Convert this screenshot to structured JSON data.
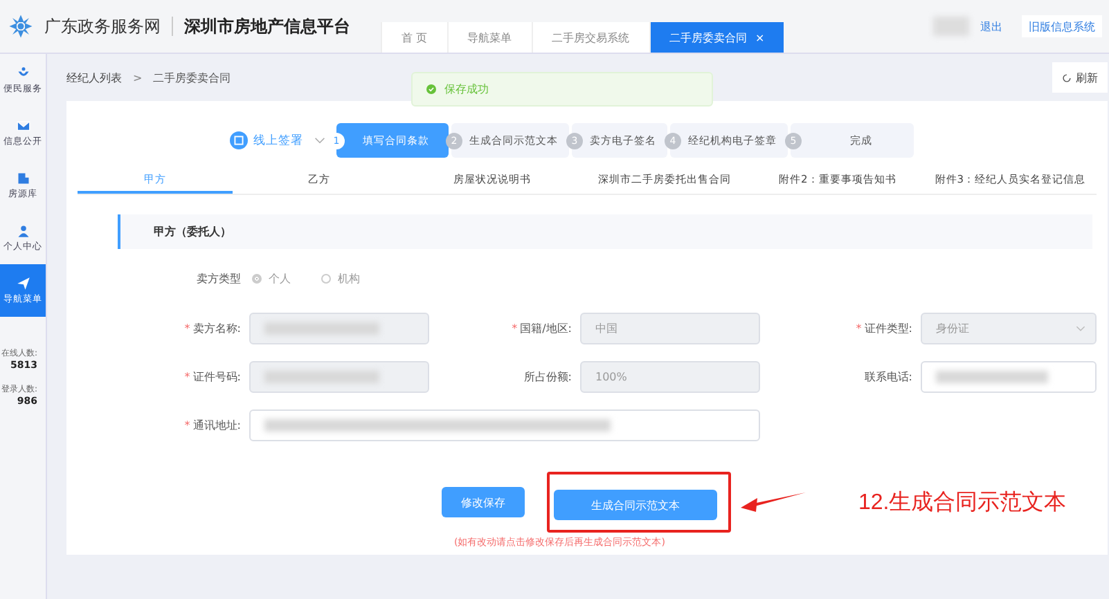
{
  "header": {
    "site_name": "广东政务服务网",
    "platform": "深圳市房地产信息平台",
    "logout": "退出",
    "old_system": "旧版信息系统",
    "tabs": [
      {
        "label": "首 页",
        "selected": false
      },
      {
        "label": "导航菜单",
        "selected": false
      },
      {
        "label": "二手房交易系统",
        "selected": false
      },
      {
        "label": "二手房委卖合同",
        "selected": true,
        "close": "×"
      }
    ]
  },
  "sidebar": {
    "items": [
      {
        "label": "便民服务",
        "kind": "service",
        "selected": false
      },
      {
        "label": "信息公开",
        "kind": "mail",
        "selected": false
      },
      {
        "label": "房源库",
        "kind": "building",
        "selected": false
      },
      {
        "label": "个人中心",
        "kind": "person",
        "selected": false
      },
      {
        "label": "导航菜单",
        "kind": "send",
        "selected": true
      }
    ],
    "stats": [
      {
        "label": "在线人数:",
        "value": "5813"
      },
      {
        "label": "登录人数:",
        "value": "986"
      }
    ]
  },
  "breadcrumb": {
    "items": [
      "经纪人列表",
      "二手房委卖合同"
    ],
    "separator": ">"
  },
  "toast": "保存成功",
  "refresh": "刷新",
  "steps": {
    "title": "线上签署",
    "items": [
      {
        "number": "1",
        "label": "填写合同条款",
        "selected": true
      },
      {
        "number": "2",
        "label": "生成合同示范文本",
        "selected": false
      },
      {
        "number": "3",
        "label": "卖方电子签名",
        "selected": false
      },
      {
        "number": "4",
        "label": "经纪机构电子签章",
        "selected": false
      },
      {
        "number": "5",
        "label": "完成",
        "selected": false
      }
    ]
  },
  "doc_tabs": [
    {
      "label": "甲方",
      "selected": true
    },
    {
      "label": "乙方",
      "selected": false
    },
    {
      "label": "房屋状况说明书",
      "selected": false
    },
    {
      "label": "深圳市二手房委托出售合同",
      "selected": false
    },
    {
      "label": "附件2：重要事项告知书",
      "selected": false
    },
    {
      "label": "附件3：经纪人员实名登记信息",
      "selected": false
    }
  ],
  "section_title": "甲方（委托人）",
  "required_mark": "*",
  "seller_type": {
    "label": "卖方类型",
    "options": [
      {
        "label": "个人",
        "selected": true
      },
      {
        "label": "机构",
        "selected": false
      }
    ]
  },
  "fields": [
    {
      "label": "卖方名称:",
      "required": true,
      "disabled": true,
      "redacted": true
    },
    {
      "label": "国籍/地区:",
      "required": true,
      "disabled": true,
      "value": "中国"
    },
    {
      "label": "证件类型:",
      "required": true,
      "disabled": true,
      "value": "身份证",
      "kind": "select"
    },
    {
      "label": "证件号码:",
      "required": true,
      "disabled": true,
      "redacted": true
    },
    {
      "label": "所占份额:",
      "required": false,
      "disabled": true,
      "value": "100%"
    },
    {
      "label": "联系电话:",
      "required": false,
      "disabled": false,
      "redacted": true
    },
    {
      "label": "通讯地址:",
      "required": true,
      "disabled": false,
      "redacted": true,
      "wide": true
    }
  ],
  "buttons": [
    {
      "label": "修改保存",
      "highlighted": false
    },
    {
      "label": "生成合同示范文本",
      "highlighted": true
    }
  ],
  "note": "(如有改动请点击修改保存后再生成合同示范文本)",
  "annotation": "12.生成合同示范文本"
}
